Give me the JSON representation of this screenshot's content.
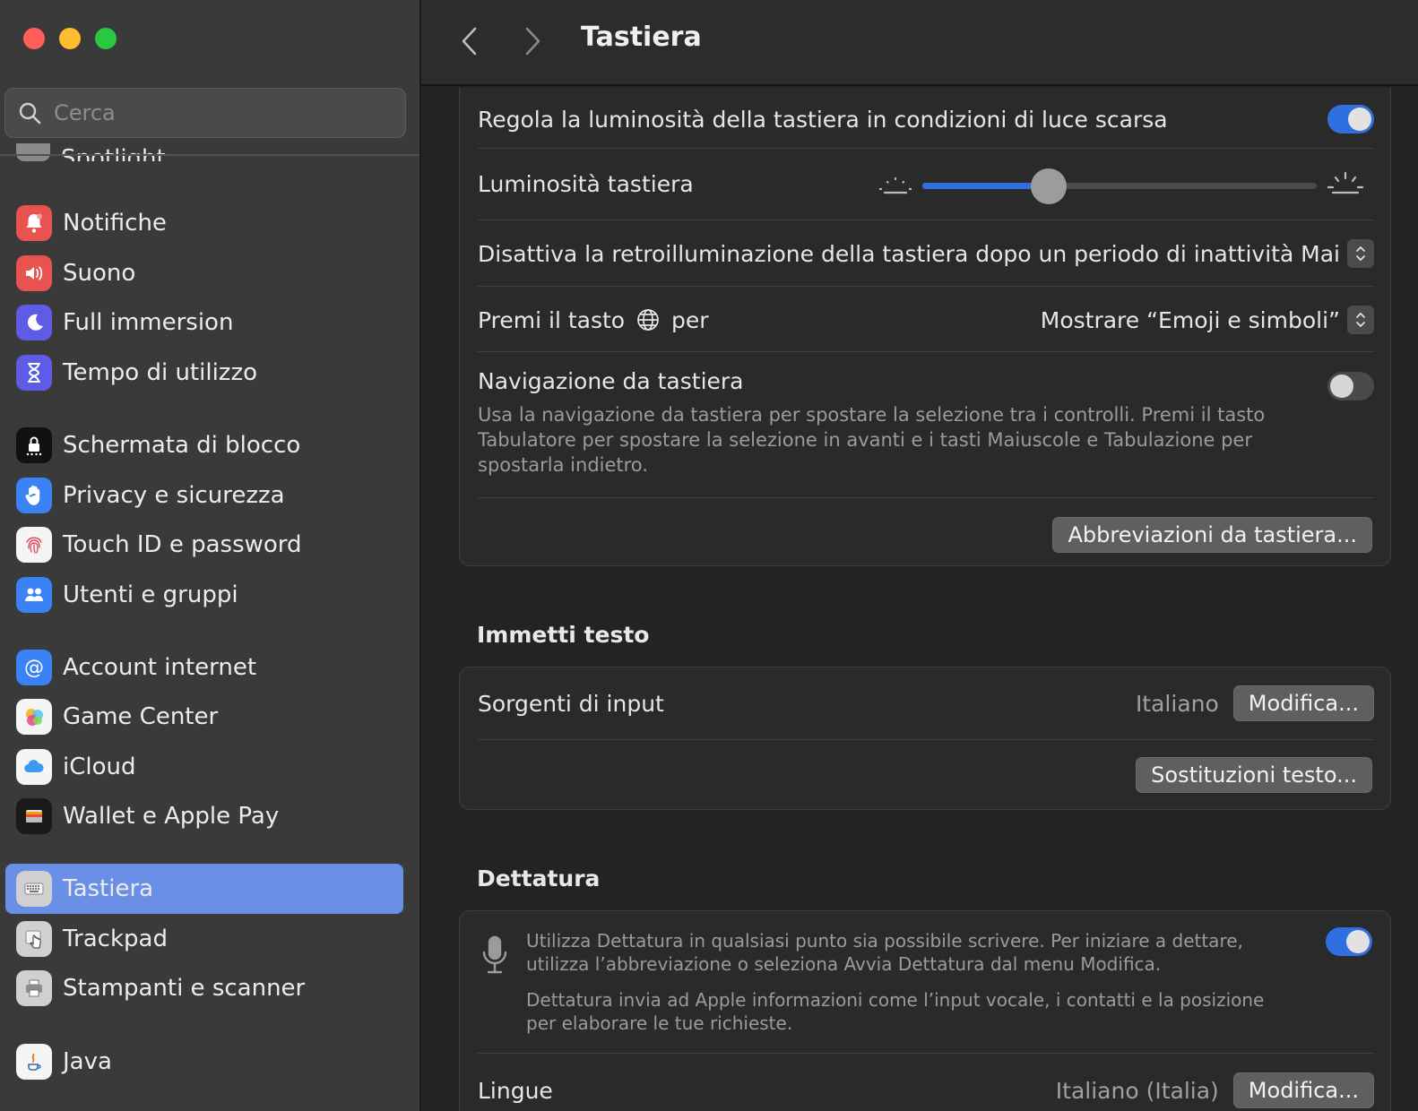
{
  "sidebar": {
    "search_placeholder": "Cerca",
    "peek_label": "Spotlight",
    "items": [
      {
        "label": "Notifiche",
        "icon": "bell-icon",
        "color": "#e8534f"
      },
      {
        "label": "Suono",
        "icon": "speaker-icon",
        "color": "#e8534f"
      },
      {
        "label": "Full immersion",
        "icon": "moon-icon",
        "color": "#5e5ce6"
      },
      {
        "label": "Tempo di utilizzo",
        "icon": "hourglass-icon",
        "color": "#5e5ce6"
      },
      {
        "label": "Schermata di blocco",
        "icon": "lock-icon",
        "color": "#111111"
      },
      {
        "label": "Privacy e sicurezza",
        "icon": "hand-icon",
        "color": "#3b82f6"
      },
      {
        "label": "Touch ID e password",
        "icon": "fingerprint-icon",
        "color": "#f5f5f5"
      },
      {
        "label": "Utenti e gruppi",
        "icon": "users-icon",
        "color": "#3b82f6"
      },
      {
        "label": "Account internet",
        "icon": "at-icon",
        "color": "#3b82f6"
      },
      {
        "label": "Game Center",
        "icon": "game-center-icon",
        "color": "#f5f5f5"
      },
      {
        "label": "iCloud",
        "icon": "cloud-icon",
        "color": "#f5f5f5"
      },
      {
        "label": "Wallet e Apple Pay",
        "icon": "wallet-icon",
        "color": "#1a1a1a"
      },
      {
        "label": "Tastiera",
        "icon": "keyboard-icon",
        "color": "#d0d0d0",
        "selected": true
      },
      {
        "label": "Trackpad",
        "icon": "trackpad-icon",
        "color": "#d0d0d0"
      },
      {
        "label": "Stampanti e scanner",
        "icon": "printer-icon",
        "color": "#d0d0d0"
      },
      {
        "label": "Java",
        "icon": "java-icon",
        "color": "#f5f5f5"
      }
    ]
  },
  "toolbar": {
    "title": "Tastiera"
  },
  "keyboard_card": {
    "brightness_auto_label": "Regola la luminosità della tastiera in condizioni di luce scarsa",
    "brightness_auto_on": true,
    "brightness_label": "Luminosità tastiera",
    "brightness_fraction": 0.32,
    "backlight_off_label": "Disattiva la retroilluminazione della tastiera dopo un periodo di inattività",
    "backlight_off_value": "Mai",
    "globe_label_before": "Premi il tasto",
    "globe_label_after": "per",
    "globe_value": "Mostrare “Emoji e simboli”",
    "nav_label": "Navigazione da tastiera",
    "nav_desc": "Usa la navigazione da tastiera per spostare la selezione tra i controlli. Premi il tasto Tabulatore per spostare la selezione in avanti e i tasti Maiuscole e Tabulazione per spostarla indietro.",
    "nav_on": false,
    "shortcuts_button": "Abbreviazioni da tastiera..."
  },
  "text_input": {
    "section_title": "Immetti testo",
    "sources_label": "Sorgenti di input",
    "sources_value": "Italiano",
    "edit_button": "Modifica...",
    "replacements_button": "Sostituzioni testo..."
  },
  "dictation": {
    "section_title": "Dettatura",
    "desc1": "Utilizza Dettatura in qualsiasi punto sia possibile scrivere. Per iniziare a dettare, utilizza l’abbreviazione o seleziona Avvia Dettatura dal menu Modifica.",
    "desc2": "Dettatura invia ad Apple informazioni come l’input vocale, i contatti e la posizione per elaborare le tue richieste.",
    "on": true,
    "languages_label": "Lingue",
    "languages_value": "Italiano (Italia)",
    "edit_button": "Modifica..."
  }
}
